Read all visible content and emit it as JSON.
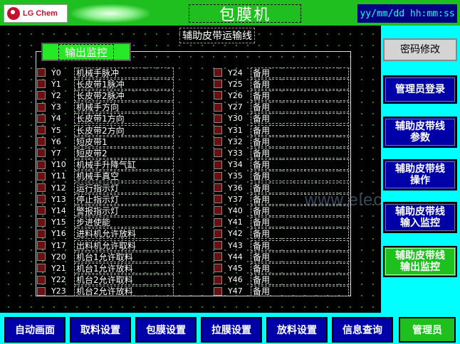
{
  "header": {
    "logo_text": "LG Chem",
    "title": "包膜机",
    "datetime": "yy/mm/dd hh:mm:ss"
  },
  "main": {
    "subtitle": "辅助皮带运输线",
    "panel_label": "输出监控",
    "left_outputs": [
      {
        "id": "Y0",
        "name": "机械手脉冲"
      },
      {
        "id": "Y1",
        "name": "长皮带1脉冲"
      },
      {
        "id": "Y2",
        "name": "长皮带2脉冲"
      },
      {
        "id": "Y3",
        "name": "机械手方向"
      },
      {
        "id": "Y4",
        "name": "长皮带1方向"
      },
      {
        "id": "Y5",
        "name": "长皮带2方向"
      },
      {
        "id": "Y6",
        "name": "短皮带1"
      },
      {
        "id": "Y7",
        "name": "短皮带2"
      },
      {
        "id": "Y10",
        "name": "机械手升降气缸"
      },
      {
        "id": "Y11",
        "name": "机械手真空"
      },
      {
        "id": "Y12",
        "name": "运行指示灯"
      },
      {
        "id": "Y13",
        "name": "停止指示灯"
      },
      {
        "id": "Y14",
        "name": "警报指示灯"
      },
      {
        "id": "Y15",
        "name": "步进使能"
      },
      {
        "id": "Y16",
        "name": "进料机允许放料"
      },
      {
        "id": "Y17",
        "name": "出料机允许取料"
      },
      {
        "id": "Y20",
        "name": "机台1允许取料"
      },
      {
        "id": "Y21",
        "name": "机台1允许放料"
      },
      {
        "id": "Y22",
        "name": "机台2允许取料"
      },
      {
        "id": "Y23",
        "name": "机台2允许放料"
      }
    ],
    "right_outputs": [
      {
        "id": "Y24",
        "name": "备用"
      },
      {
        "id": "Y25",
        "name": "备用"
      },
      {
        "id": "Y26",
        "name": "备用"
      },
      {
        "id": "Y27",
        "name": "备用"
      },
      {
        "id": "Y30",
        "name": "备用"
      },
      {
        "id": "Y31",
        "name": "备用"
      },
      {
        "id": "Y32",
        "name": "备用"
      },
      {
        "id": "Y33",
        "name": "备用"
      },
      {
        "id": "Y34",
        "name": "备用"
      },
      {
        "id": "Y35",
        "name": "备用"
      },
      {
        "id": "Y36",
        "name": "备用"
      },
      {
        "id": "Y37",
        "name": "备用"
      },
      {
        "id": "Y40",
        "name": "备用"
      },
      {
        "id": "Y41",
        "name": "备用"
      },
      {
        "id": "Y42",
        "name": "备用"
      },
      {
        "id": "Y43",
        "name": "备用"
      },
      {
        "id": "Y44",
        "name": "备用"
      },
      {
        "id": "Y45",
        "name": "备用"
      },
      {
        "id": "Y46",
        "name": "备用"
      },
      {
        "id": "Y47",
        "name": "备用"
      }
    ]
  },
  "sidebar": {
    "password_change": "密码修改",
    "admin_login": "管理员登录",
    "aux_belt_params": "辅助皮带线\n参数",
    "aux_belt_operation": "辅助皮带线\n操作",
    "aux_belt_input_monitor": "辅助皮带线\n输入监控",
    "aux_belt_output_monitor": "辅助皮带线\n输出监控"
  },
  "bottom_nav": {
    "auto_screen": "自动画面",
    "pick_settings": "取料设置",
    "wrap_settings": "包膜设置",
    "stretch_settings": "拉膜设置",
    "place_settings": "放料设置",
    "info_query": "信息查询",
    "admin": "管理员"
  },
  "watermark": "www.elec...m",
  "colors": {
    "header_green": "#1fbf1f",
    "datetime_bg": "#000080",
    "datetime_text": "#00ffff",
    "side_bg": "#00ffff",
    "button_blue": "#0000a8",
    "button_active_green": "#1ec01e",
    "led_off": "#6b1010"
  }
}
